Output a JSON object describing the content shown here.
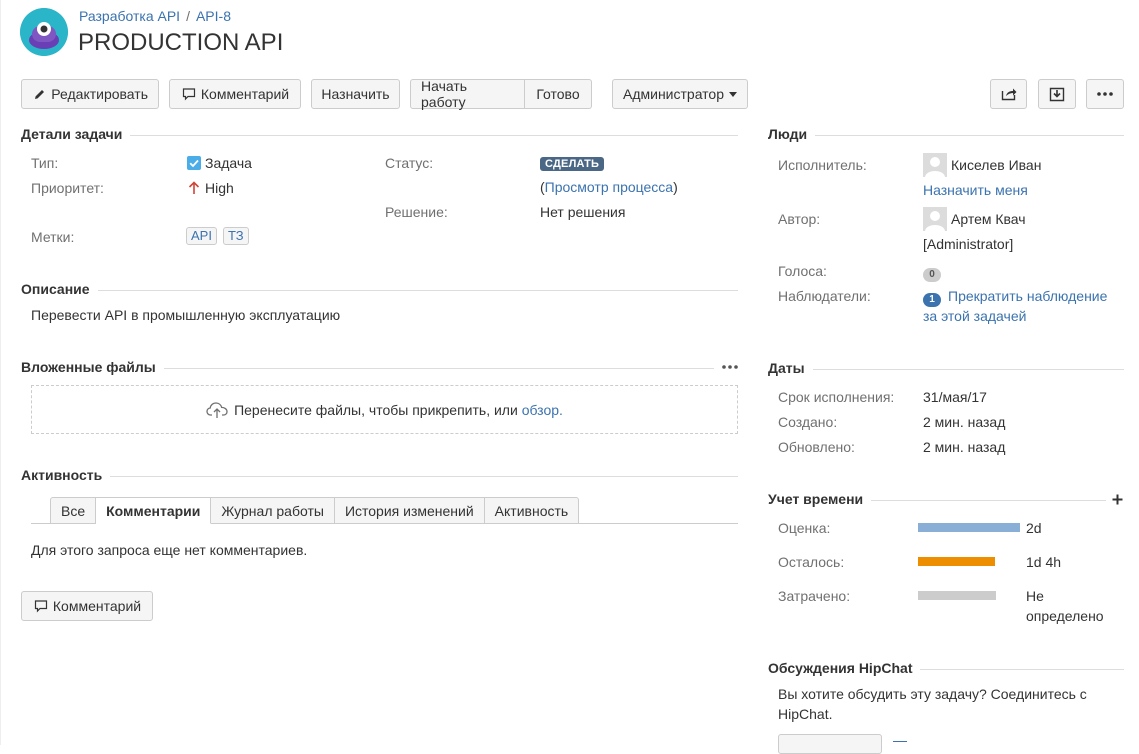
{
  "header": {
    "breadcrumb_project": "Разработка API",
    "breadcrumb_sep": "/",
    "breadcrumb_issue": "API-8",
    "title": "PRODUCTION API"
  },
  "toolbar": {
    "edit": "Редактировать",
    "comment": "Комментарий",
    "assign": "Назначить",
    "start": "Начать работу",
    "done": "Готово",
    "admin": "Администратор"
  },
  "details": {
    "heading": "Детали задачи",
    "type_label": "Тип:",
    "type_value": "Задача",
    "priority_label": "Приоритет:",
    "priority_value": "High",
    "labels_label": "Метки:",
    "labels": [
      "API",
      "ТЗ"
    ],
    "status_label": "Статус:",
    "status_value": "СДЕЛАТЬ",
    "view_workflow": "Просмотр процесса",
    "resolution_label": "Решение:",
    "resolution_value": "Нет решения"
  },
  "description": {
    "heading": "Описание",
    "text": "Перевести API в промышленную эксплуатацию"
  },
  "attachments": {
    "heading": "Вложенные файлы",
    "drop_text": "Перенесите файлы, чтобы прикрепить, или",
    "browse": "обзор."
  },
  "activity": {
    "heading": "Активность",
    "tabs": [
      "Все",
      "Комментарии",
      "Журнал работы",
      "История изменений",
      "Активность"
    ],
    "active_tab": 1,
    "empty": "Для этого запроса еще нет комментариев.",
    "comment_button": "Комментарий"
  },
  "people": {
    "heading": "Люди",
    "assignee_label": "Исполнитель:",
    "assignee": "Киселев Иван",
    "assign_to_me": "Назначить меня",
    "reporter_label": "Автор:",
    "reporter": "Артем Квач",
    "reporter_role": "[Administrator]",
    "votes_label": "Голоса:",
    "votes": "0",
    "watchers_label": "Наблюдатели:",
    "watchers": "1",
    "stop_watching_1": "Прекратить наблюдение",
    "stop_watching_2": "за этой задачей"
  },
  "dates": {
    "heading": "Даты",
    "due_label": "Срок исполнения:",
    "due": "31/мая/17",
    "created_label": "Создано:",
    "created": "2 мин. назад",
    "updated_label": "Обновлено:",
    "updated": "2 мин. назад"
  },
  "time": {
    "heading": "Учет времени",
    "estimate_label": "Оценка:",
    "estimate": "2d",
    "estimate_fill": 1.0,
    "remaining_label": "Осталось:",
    "remaining": "1d 4h",
    "remaining_fill": 0.75,
    "logged_label": "Затрачено:",
    "logged_1": "Не",
    "logged_2": "определено",
    "colors": {
      "estimate": "#89afd7",
      "remaining": "#ec8e00",
      "logged": "#cccccc"
    }
  },
  "hipchat": {
    "heading": "Обсуждения HipChat",
    "text_1": "Вы хотите обсудить эту задачу? Соединитесь с",
    "text_2": "HipChat."
  }
}
